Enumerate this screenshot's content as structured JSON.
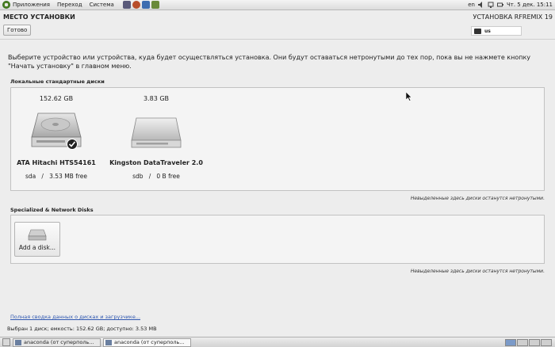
{
  "top_panel": {
    "menu": [
      "Приложения",
      "Переход",
      "Система"
    ],
    "lang": "en",
    "clock": "Чт.  5 дек. 15:11"
  },
  "header": {
    "title": "МЕСТО УСТАНОВКИ",
    "done_label": "Готово",
    "install_title": "УСТАНОВКА RFREMIX 19",
    "keyboard_layout": "us"
  },
  "intro_text": "Выберите устройство или устройства, куда будет осуществляться установка. Они будут оставаться нетронутыми до тех пор, пока вы не нажмете кнопку \"Начать установку\" в главном меню.",
  "local_section": {
    "label": "Локальные стандартные диски",
    "disks": [
      {
        "size": "152.62 GB",
        "name": "ATA Hitachi HTS54161",
        "dev": "sda",
        "free": "3.53 MB free",
        "sep": "/",
        "selected": true
      },
      {
        "size": "3.83 GB",
        "name": "Kingston DataTraveler 2.0",
        "dev": "sdb",
        "free": "0 B free",
        "sep": "/",
        "selected": false
      }
    ],
    "note": "Невыделенные здесь диски останутся нетронутыми."
  },
  "special_section": {
    "label": "Specialized & Network Disks",
    "add_label": "Add a disk...",
    "note": "Невыделенные здесь диски останутся нетронутыми."
  },
  "summary_link": "Полная сводка данных о дисках и загрузчике...",
  "status": "Выбран 1 диск; емкость: 152.62 GB; доступно: 3.53 MB",
  "taskbar": {
    "tasks": [
      "anaconda (от суперполь...",
      "anaconda (от суперполь..."
    ]
  }
}
